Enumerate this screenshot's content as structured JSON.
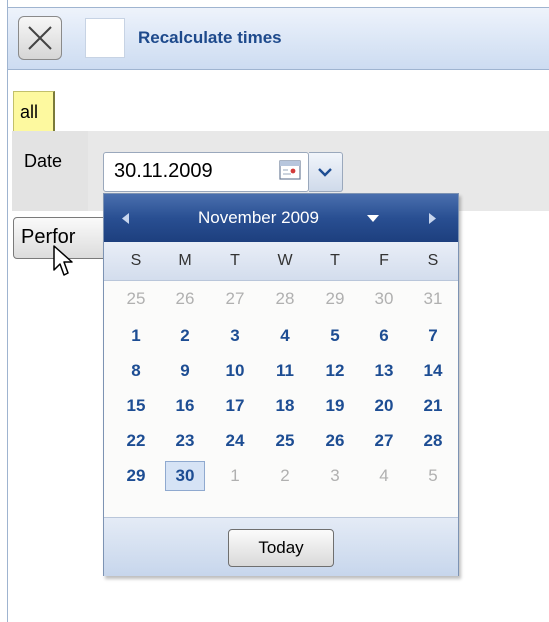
{
  "toolbar": {
    "title": "Recalculate times",
    "close_icon": "close-icon"
  },
  "tabs": [
    {
      "label": "all",
      "active": true
    }
  ],
  "form": {
    "date_label": "Date",
    "date_value": "30.11.2009",
    "perform_label": "Perfor"
  },
  "calendar": {
    "month_label": "November 2009",
    "weekdays": [
      "S",
      "M",
      "T",
      "W",
      "T",
      "F",
      "S"
    ],
    "weeks": [
      [
        {
          "d": "25",
          "o": true
        },
        {
          "d": "26",
          "o": true
        },
        {
          "d": "27",
          "o": true
        },
        {
          "d": "28",
          "o": true
        },
        {
          "d": "29",
          "o": true
        },
        {
          "d": "30",
          "o": true
        },
        {
          "d": "31",
          "o": true
        }
      ],
      [
        {
          "d": "1"
        },
        {
          "d": "2"
        },
        {
          "d": "3"
        },
        {
          "d": "4"
        },
        {
          "d": "5"
        },
        {
          "d": "6"
        },
        {
          "d": "7"
        }
      ],
      [
        {
          "d": "8"
        },
        {
          "d": "9"
        },
        {
          "d": "10"
        },
        {
          "d": "11"
        },
        {
          "d": "12"
        },
        {
          "d": "13"
        },
        {
          "d": "14"
        }
      ],
      [
        {
          "d": "15"
        },
        {
          "d": "16"
        },
        {
          "d": "17"
        },
        {
          "d": "18"
        },
        {
          "d": "19"
        },
        {
          "d": "20"
        },
        {
          "d": "21"
        }
      ],
      [
        {
          "d": "22"
        },
        {
          "d": "23"
        },
        {
          "d": "24"
        },
        {
          "d": "25"
        },
        {
          "d": "26"
        },
        {
          "d": "27"
        },
        {
          "d": "28"
        }
      ],
      [
        {
          "d": "29"
        },
        {
          "d": "30",
          "sel": true
        },
        {
          "d": "1",
          "o": true
        },
        {
          "d": "2",
          "o": true
        },
        {
          "d": "3",
          "o": true
        },
        {
          "d": "4",
          "o": true
        },
        {
          "d": "5",
          "o": true
        }
      ]
    ],
    "today_label": "Today"
  },
  "colors": {
    "accent": "#1d4d93",
    "header": "#294f92",
    "tab_active": "#fdf99f"
  }
}
